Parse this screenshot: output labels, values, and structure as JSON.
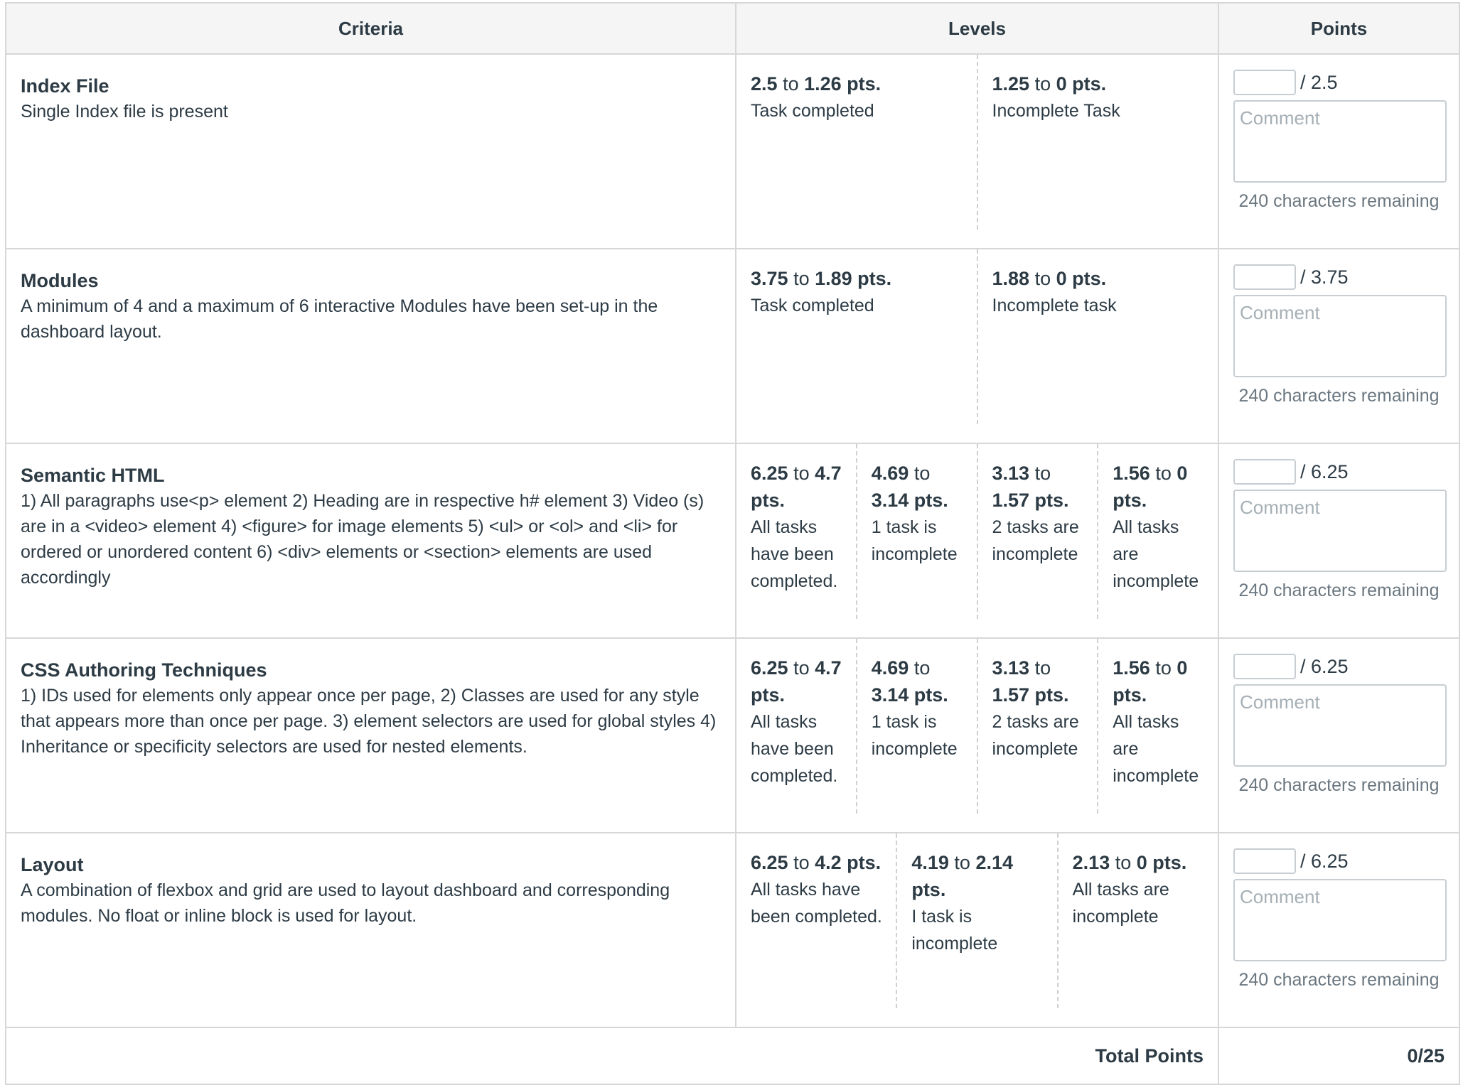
{
  "headers": {
    "criteria": "Criteria",
    "levels": "Levels",
    "points": "Points"
  },
  "comment_placeholder": "Comment",
  "criteria": [
    {
      "name": "Index File",
      "description": "Single Index file is present",
      "max_label": "/ 2.5",
      "score_value": "",
      "chars_remaining": "240 characters remaining",
      "levels": [
        {
          "from": "2.5",
          "to_word": "to",
          "to": "1.26 pts.",
          "desc": "Task completed"
        },
        {
          "from": "1.25",
          "to_word": "to",
          "to": "0 pts.",
          "desc": "Incomplete Task"
        }
      ]
    },
    {
      "name": "Modules",
      "description": "A minimum of 4 and a maximum of 6 interactive Modules have been set-up in the dashboard layout.",
      "max_label": "/ 3.75",
      "score_value": "",
      "chars_remaining": "240 characters remaining",
      "levels": [
        {
          "from": "3.75",
          "to_word": "to",
          "to": "1.89 pts.",
          "desc": "Task completed"
        },
        {
          "from": "1.88",
          "to_word": "to",
          "to": "0 pts.",
          "desc": "Incomplete task"
        }
      ]
    },
    {
      "name": "Semantic HTML",
      "description": "1) All paragraphs use<p> element 2) Heading are in respective h# element 3) Video (s) are in a <video> element 4) <figure> for image elements 5) <ul> or <ol> and <li> for ordered or unordered content 6) <div> elements or <section> elements are used accordingly",
      "max_label": "/ 6.25",
      "score_value": "",
      "chars_remaining": "240 characters remaining",
      "levels": [
        {
          "from": "6.25",
          "to_word": "to",
          "to": "4.7 pts.",
          "desc": "All tasks have been completed."
        },
        {
          "from": "4.69",
          "to_word": "to",
          "to": "3.14 pts.",
          "desc": "1 task is incomplete"
        },
        {
          "from": "3.13",
          "to_word": "to",
          "to": "1.57 pts.",
          "desc": "2 tasks are incomplete"
        },
        {
          "from": "1.56",
          "to_word": "to",
          "to": "0 pts.",
          "desc": "All tasks are incomplete"
        }
      ]
    },
    {
      "name": "CSS Authoring Techniques",
      "description": "1) IDs used for elements only appear once per page, 2) Classes are used for any style that appears more than once per page. 3) element selectors are used for global styles 4) Inheritance or specificity selectors are used for nested elements.",
      "max_label": "/ 6.25",
      "score_value": "",
      "chars_remaining": "240 characters remaining",
      "levels": [
        {
          "from": "6.25",
          "to_word": "to",
          "to": "4.7 pts.",
          "desc": "All tasks have been completed."
        },
        {
          "from": "4.69",
          "to_word": "to",
          "to": "3.14 pts.",
          "desc": "1 task is incomplete"
        },
        {
          "from": "3.13",
          "to_word": "to",
          "to": "1.57 pts.",
          "desc": "2 tasks are incomplete"
        },
        {
          "from": "1.56",
          "to_word": "to",
          "to": "0 pts.",
          "desc": "All tasks are incomplete"
        }
      ]
    },
    {
      "name": "Layout",
      "description": "A combination of flexbox and grid are used to layout dashboard and corresponding modules. No float or inline block is used for layout.",
      "max_label": "/ 6.25",
      "score_value": "",
      "chars_remaining": "240 characters remaining",
      "levels": [
        {
          "from": "6.25",
          "to_word": "to",
          "to": "4.2 pts.",
          "desc": "All tasks have been completed."
        },
        {
          "from": "4.19",
          "to_word": "to",
          "to": "2.14 pts.",
          "desc": "I task is incomplete"
        },
        {
          "from": "2.13",
          "to_word": "to",
          "to": "0 pts.",
          "desc": "All tasks are incomplete"
        }
      ]
    }
  ],
  "total": {
    "label": "Total Points",
    "value": "0/25"
  }
}
